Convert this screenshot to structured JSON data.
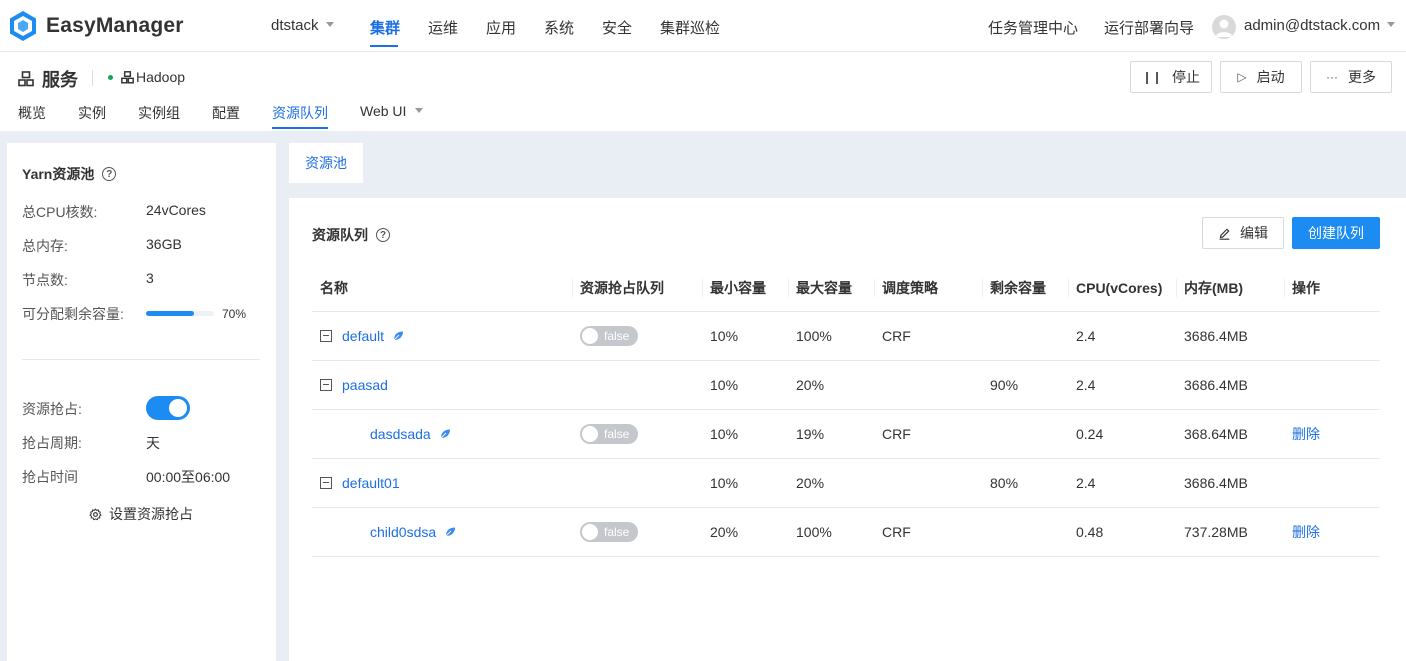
{
  "app": {
    "name": "EasyManager"
  },
  "topnav": {
    "cluster_select": "dtstack",
    "items": [
      "集群",
      "运维",
      "应用",
      "系统",
      "安全",
      "集群巡检"
    ],
    "active": "集群",
    "right_links": [
      "任务管理中心",
      "运行部署向导"
    ],
    "user": "admin@dtstack.com"
  },
  "service": {
    "title": "服务",
    "name": "Hadoop",
    "buttons": {
      "stop": "停止",
      "start": "启动",
      "more": "更多"
    },
    "tabs": [
      "概览",
      "实例",
      "实例组",
      "配置",
      "资源队列",
      "Web UI"
    ],
    "active_tab": "资源队列"
  },
  "yarn_pool": {
    "title": "Yarn资源池",
    "cpu_label": "总CPU核数:",
    "cpu_value": "24vCores",
    "mem_label": "总内存:",
    "mem_value": "36GB",
    "nodes_label": "节点数:",
    "nodes_value": "3",
    "remaining_label": "可分配剩余容量:",
    "remaining_percent": 70,
    "remaining_text": "70%",
    "preempt_label": "资源抢占:",
    "preempt_enabled": true,
    "period_label": "抢占周期:",
    "period_value": "天",
    "time_label": "抢占时间",
    "time_value": "00:00至06:00",
    "setting_label": "设置资源抢占"
  },
  "pool_tab": "资源池",
  "queue": {
    "title": "资源队列",
    "edit_label": "编辑",
    "create_label": "创建队列",
    "columns": [
      "名称",
      "资源抢占队列",
      "最小容量",
      "最大容量",
      "调度策略",
      "剩余容量",
      "CPU(vCores)",
      "内存(MB)",
      "操作"
    ],
    "rows": [
      {
        "name": "default",
        "preempt": "false",
        "min": "10%",
        "max": "100%",
        "policy": "CRF",
        "remaining": "",
        "cpu": "2.4",
        "mem": "3686.4MB",
        "action": ""
      },
      {
        "name": "paasad",
        "preempt": "",
        "min": "10%",
        "max": "20%",
        "policy": "",
        "remaining": "90%",
        "cpu": "2.4",
        "mem": "3686.4MB",
        "action": ""
      },
      {
        "name": "dasdsada",
        "preempt": "false",
        "min": "10%",
        "max": "19%",
        "policy": "CRF",
        "remaining": "",
        "cpu": "0.24",
        "mem": "368.64MB",
        "action": "删除"
      },
      {
        "name": "default01",
        "preempt": "",
        "min": "10%",
        "max": "20%",
        "policy": "",
        "remaining": "80%",
        "cpu": "2.4",
        "mem": "3686.4MB",
        "action": ""
      },
      {
        "name": "child0sdsa",
        "preempt": "false",
        "min": "20%",
        "max": "100%",
        "policy": "CRF",
        "remaining": "",
        "cpu": "0.48",
        "mem": "737.28MB",
        "action": "删除"
      }
    ]
  },
  "colors": {
    "accent": "#1d6fe6",
    "primary_button": "#1d8cf2",
    "status_green": "#19a15f",
    "background": "#e9edf4"
  }
}
